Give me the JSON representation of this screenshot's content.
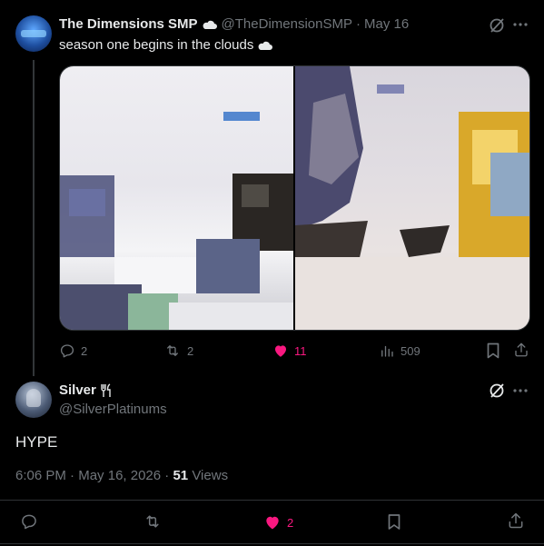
{
  "tweet": {
    "author_name": "The Dimensions SMP",
    "author_handle": "@TheDimensionSMP",
    "date": "May 16",
    "text": "season one begins in the clouds",
    "actions": {
      "replies": "2",
      "reposts": "2",
      "likes": "11",
      "views": "509"
    }
  },
  "reply": {
    "author_name": "Silver",
    "author_handle": "@SilverPlatinums",
    "text": "HYPE",
    "time": "6:06 PM",
    "date": "May 16, 2026",
    "views_count": "51",
    "views_label": "Views",
    "actions": {
      "likes": "2"
    }
  },
  "colors": {
    "like_active": "#f91880",
    "muted": "#71767b",
    "text": "#e7e9ea",
    "divider": "#2f3336"
  }
}
